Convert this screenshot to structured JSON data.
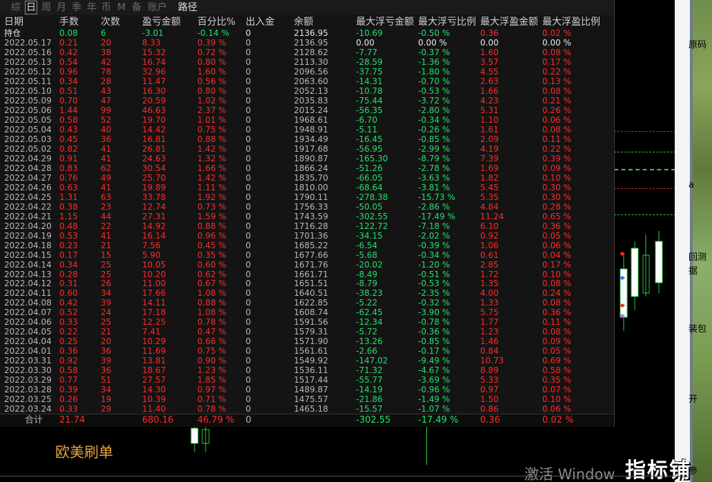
{
  "tabs": [
    {
      "label": "综",
      "state": "dim"
    },
    {
      "label": "日",
      "state": "active"
    },
    {
      "label": "周",
      "state": "dim"
    },
    {
      "label": "月",
      "state": "dim"
    },
    {
      "label": "季",
      "state": "dim"
    },
    {
      "label": "年",
      "state": "dim"
    },
    {
      "label": "币",
      "state": "dim"
    },
    {
      "label": "M",
      "state": "dim"
    },
    {
      "label": "备",
      "state": "dim"
    },
    {
      "label": "账户",
      "state": "dim"
    },
    {
      "label": "路径",
      "state": "bright"
    }
  ],
  "columns": [
    "日期",
    "手数",
    "次数",
    "盈亏金额",
    "百分比%",
    "出入金",
    "余额",
    "最大浮亏金额",
    "最大浮亏比例",
    "最大浮盈金额",
    "最大浮盈比例"
  ],
  "rows": [
    [
      "持仓",
      "0.08",
      "6",
      "-3.01",
      "-0.14 %",
      "0",
      "2136.95",
      "-10.69",
      "-0.50 %",
      "0.36",
      "0.02 %"
    ],
    [
      "2022.05.17",
      "0.21",
      "20",
      "8.33",
      "0.39 %",
      "0",
      "2136.95",
      "0.00",
      "0.00 %",
      "0.00",
      "0.00 %"
    ],
    [
      "2022.05.16",
      "0.42",
      "38",
      "15.32",
      "0.72 %",
      "0",
      "2128.62",
      "-7.77",
      "-0.37 %",
      "1.60",
      "0.08 %"
    ],
    [
      "2022.05.13",
      "0.54",
      "42",
      "16.74",
      "0.80 %",
      "0",
      "2113.30",
      "-28.59",
      "-1.36 %",
      "3.57",
      "0.17 %"
    ],
    [
      "2022.05.12",
      "0.96",
      "78",
      "32.96",
      "1.60 %",
      "0",
      "2096.56",
      "-37.75",
      "-1.80 %",
      "4.55",
      "0.22 %"
    ],
    [
      "2022.05.11",
      "0.34",
      "28",
      "11.47",
      "0.56 %",
      "0",
      "2063.60",
      "-14.31",
      "-0.70 %",
      "2.63",
      "0.13 %"
    ],
    [
      "2022.05.10",
      "0.51",
      "43",
      "16.30",
      "0.80 %",
      "0",
      "2052.13",
      "-10.78",
      "-0.53 %",
      "1.66",
      "0.08 %"
    ],
    [
      "2022.05.09",
      "0.70",
      "47",
      "20.59",
      "1.02 %",
      "0",
      "2035.83",
      "-75.44",
      "-3.72 %",
      "4.23",
      "0.21 %"
    ],
    [
      "2022.05.06",
      "1.44",
      "99",
      "46.63",
      "2.37 %",
      "0",
      "2015.24",
      "-56.35",
      "-2.80 %",
      "5.31",
      "0.26 %"
    ],
    [
      "2022.05.05",
      "0.58",
      "52",
      "19.70",
      "1.01 %",
      "0",
      "1968.61",
      "-6.70",
      "-0.34 %",
      "1.10",
      "0.06 %"
    ],
    [
      "2022.05.04",
      "0.43",
      "40",
      "14.42",
      "0.75 %",
      "0",
      "1948.91",
      "-5.11",
      "-0.26 %",
      "1.61",
      "0.08 %"
    ],
    [
      "2022.05.03",
      "0.45",
      "36",
      "16.81",
      "0.88 %",
      "0",
      "1934.49",
      "-16.45",
      "-0.85 %",
      "2.09",
      "0.11 %"
    ],
    [
      "2022.05.02",
      "0.82",
      "41",
      "26.81",
      "1.42 %",
      "0",
      "1917.68",
      "-56.95",
      "-2.99 %",
      "4.19",
      "0.22 %"
    ],
    [
      "2022.04.29",
      "0.91",
      "41",
      "24.63",
      "1.32 %",
      "0",
      "1890.87",
      "-165.30",
      "-8.79 %",
      "7.39",
      "0.39 %"
    ],
    [
      "2022.04.28",
      "0.83",
      "62",
      "30.54",
      "1.66 %",
      "0",
      "1866.24",
      "-51.26",
      "-2.78 %",
      "1.69",
      "0.09 %"
    ],
    [
      "2022.04.27",
      "0.76",
      "49",
      "25.70",
      "1.42 %",
      "0",
      "1835.70",
      "-66.05",
      "-3.63 %",
      "1.82",
      "0.10 %"
    ],
    [
      "2022.04.26",
      "0.63",
      "41",
      "19.89",
      "1.11 %",
      "0",
      "1810.00",
      "-68.64",
      "-3.81 %",
      "5.45",
      "0.30 %"
    ],
    [
      "2022.04.25",
      "1.31",
      "63",
      "33.78",
      "1.92 %",
      "0",
      "1790.11",
      "-278.38",
      "-15.73 %",
      "5.35",
      "0.30 %"
    ],
    [
      "2022.04.22",
      "0.38",
      "23",
      "12.74",
      "0.73 %",
      "0",
      "1756.33",
      "-50.05",
      "-2.86 %",
      "4.84",
      "0.28 %"
    ],
    [
      "2022.04.21",
      "1.15",
      "44",
      "27.31",
      "1.59 %",
      "0",
      "1743.59",
      "-302.55",
      "-17.49 %",
      "11.24",
      "0.65 %"
    ],
    [
      "2022.04.20",
      "0.48",
      "22",
      "14.92",
      "0.88 %",
      "0",
      "1716.28",
      "-122.72",
      "-7.18 %",
      "6.10",
      "0.36 %"
    ],
    [
      "2022.04.19",
      "0.53",
      "41",
      "16.14",
      "0.96 %",
      "0",
      "1701.36",
      "-34.15",
      "-2.02 %",
      "0.92",
      "0.05 %"
    ],
    [
      "2022.04.18",
      "0.23",
      "21",
      "7.56",
      "0.45 %",
      "0",
      "1685.22",
      "-6.54",
      "-0.39 %",
      "1.06",
      "0.06 %"
    ],
    [
      "2022.04.15",
      "0.17",
      "15",
      "5.90",
      "0.35 %",
      "0",
      "1677.66",
      "-5.68",
      "-0.34 %",
      "0.61",
      "0.04 %"
    ],
    [
      "2022.04.14",
      "0.34",
      "25",
      "10.05",
      "0.60 %",
      "0",
      "1671.76",
      "-20.02",
      "-1.20 %",
      "2.85",
      "0.17 %"
    ],
    [
      "2022.04.13",
      "0.28",
      "25",
      "10.20",
      "0.62 %",
      "0",
      "1661.71",
      "-8.49",
      "-0.51 %",
      "1.72",
      "0.10 %"
    ],
    [
      "2022.04.12",
      "0.31",
      "26",
      "11.00",
      "0.67 %",
      "0",
      "1651.51",
      "-8.79",
      "-0.53 %",
      "1.35",
      "0.08 %"
    ],
    [
      "2022.04.11",
      "0.60",
      "34",
      "17.66",
      "1.08 %",
      "0",
      "1640.51",
      "-38.23",
      "-2.35 %",
      "4.00",
      "0.24 %"
    ],
    [
      "2022.04.08",
      "0.42",
      "39",
      "14.11",
      "0.88 %",
      "0",
      "1622.85",
      "-5.22",
      "-0.32 %",
      "1.33",
      "0.08 %"
    ],
    [
      "2022.04.07",
      "0.52",
      "24",
      "17.18",
      "1.08 %",
      "0",
      "1608.74",
      "-62.45",
      "-3.90 %",
      "5.75",
      "0.36 %"
    ],
    [
      "2022.04.06",
      "0.33",
      "25",
      "12.25",
      "0.78 %",
      "0",
      "1591.56",
      "-12.34",
      "-0.78 %",
      "1.77",
      "0.11 %"
    ],
    [
      "2022.04.05",
      "0.22",
      "21",
      "7.41",
      "0.47 %",
      "0",
      "1579.31",
      "-5.72",
      "-0.36 %",
      "1.23",
      "0.08 %"
    ],
    [
      "2022.04.04",
      "0.25",
      "20",
      "10.29",
      "0.66 %",
      "0",
      "1571.90",
      "-13.26",
      "-0.85 %",
      "1.46",
      "0.09 %"
    ],
    [
      "2022.04.01",
      "0.36",
      "36",
      "11.69",
      "0.75 %",
      "0",
      "1561.61",
      "-2.66",
      "-0.17 %",
      "0.84",
      "0.05 %"
    ],
    [
      "2022.03.31",
      "0.92",
      "39",
      "13.81",
      "0.90 %",
      "0",
      "1549.92",
      "-147.02",
      "-9.49 %",
      "10.73",
      "0.69 %"
    ],
    [
      "2022.03.30",
      "0.58",
      "36",
      "18.67",
      "1.23 %",
      "0",
      "1536.11",
      "-71.32",
      "-4.67 %",
      "8.89",
      "0.58 %"
    ],
    [
      "2022.03.29",
      "0.77",
      "51",
      "27.57",
      "1.85 %",
      "0",
      "1517.44",
      "-55.77",
      "-3.69 %",
      "5.33",
      "0.35 %"
    ],
    [
      "2022.03.28",
      "0.39",
      "34",
      "14.30",
      "0.97 %",
      "0",
      "1489.87",
      "-14.19",
      "-0.96 %",
      "0.97",
      "0.07 %"
    ],
    [
      "2022.03.25",
      "0.26",
      "19",
      "10.39",
      "0.71 %",
      "0",
      "1475.57",
      "-21.86",
      "-1.49 %",
      "1.50",
      "0.10 %"
    ],
    [
      "2022.03.24",
      "0.33",
      "29",
      "11.40",
      "0.78 %",
      "0",
      "1465.18",
      "-15.57",
      "-1.07 %",
      "0.86",
      "0.06 %"
    ]
  ],
  "totals": {
    "label": "合计",
    "lots": "21.74",
    "pnl": "680.16",
    "pct": "46.79 %",
    "io": "0",
    "max_loss": "-302.55",
    "max_loss_pct": "-17.49 %",
    "max_gain": "0.36",
    "max_gain_pct": "0.02 %"
  },
  "right_labels": [
    "原码",
    "a",
    "回测",
    "据",
    "装包",
    "开",
    "参"
  ],
  "brand_label": "欧美刷单",
  "activate_text": "激活 Window",
  "logo_text": "指标铺",
  "colors": {
    "profit": "#ff2a2a",
    "loss": "#22e06a",
    "neutral": "#b9b9b9",
    "brand": "#e8a43c"
  }
}
